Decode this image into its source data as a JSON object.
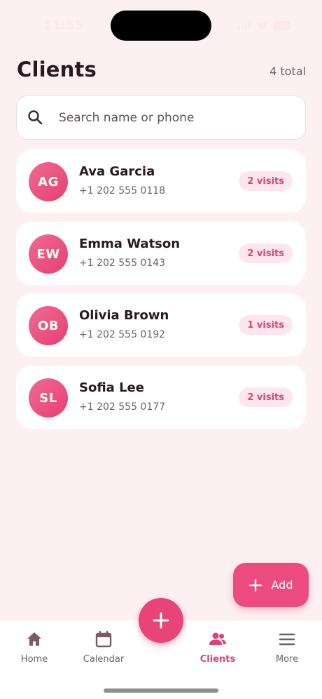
{
  "status_bar": {
    "time": "11:55"
  },
  "header": {
    "title": "Clients",
    "total": "4 total"
  },
  "search": {
    "placeholder": "Search name or phone"
  },
  "clients": [
    {
      "initials": "AG",
      "name": "Ava Garcia",
      "phone": "+1 202 555 0118",
      "visits": "2 visits"
    },
    {
      "initials": "EW",
      "name": "Emma Watson",
      "phone": "+1 202 555 0143",
      "visits": "2 visits"
    },
    {
      "initials": "OB",
      "name": "Olivia Brown",
      "phone": "+1 202 555 0192",
      "visits": "1 visits"
    },
    {
      "initials": "SL",
      "name": "Sofia Lee",
      "phone": "+1 202 555 0177",
      "visits": "2 visits"
    }
  ],
  "add_button": {
    "label": "Add"
  },
  "nav": {
    "home": "Home",
    "calendar": "Calendar",
    "clients": "Clients",
    "more": "More",
    "active": "clients"
  },
  "colors": {
    "accent": "#e84478",
    "background": "#fdf0f3",
    "badge_bg": "#fde6ee",
    "nav_active": "#e0407a",
    "nav_inactive": "#7a5a66"
  },
  "icons": {
    "search": "search-icon",
    "add": "plus-icon",
    "home": "home-icon",
    "calendar": "calendar-icon",
    "clients": "people-icon",
    "more": "menu-icon"
  }
}
